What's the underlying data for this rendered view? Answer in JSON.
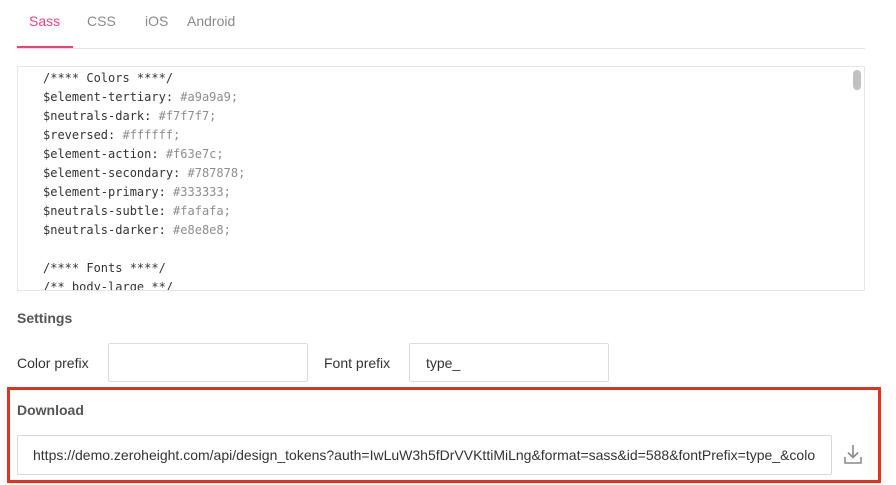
{
  "tabs": [
    {
      "label": "Sass",
      "active": true
    },
    {
      "label": "CSS",
      "active": false
    },
    {
      "label": "iOS",
      "active": false
    },
    {
      "label": "Android",
      "active": false
    }
  ],
  "code": {
    "lines": [
      {
        "text": "/**** Colors ****/",
        "kind": "comment"
      },
      {
        "name": "$element-tertiary: ",
        "value": "#a9a9a9;"
      },
      {
        "name": "$neutrals-dark: ",
        "value": "#f7f7f7;"
      },
      {
        "name": "$reversed: ",
        "value": "#ffffff;"
      },
      {
        "name": "$element-action: ",
        "value": "#f63e7c;"
      },
      {
        "name": "$element-secondary: ",
        "value": "#787878;"
      },
      {
        "name": "$element-primary: ",
        "value": "#333333;"
      },
      {
        "name": "$neutrals-subtle: ",
        "value": "#fafafa;"
      },
      {
        "name": "$neutrals-darker: ",
        "value": "#e8e8e8;"
      },
      {
        "text": "",
        "kind": "blank"
      },
      {
        "text": "/**** Fonts ****/",
        "kind": "comment"
      },
      {
        "text": "/** body-large **/",
        "kind": "comment"
      }
    ]
  },
  "settings": {
    "heading": "Settings",
    "color_prefix_label": "Color prefix",
    "color_prefix_value": "",
    "font_prefix_label": "Font prefix",
    "font_prefix_value": "type_"
  },
  "download": {
    "heading": "Download",
    "url": "https://demo.zeroheight.com/api/design_tokens?auth=IwLuW3h5fDrVVKttiMiLng&format=sass&id=588&fontPrefix=type_&colorPrefix=",
    "icon": "download-icon"
  },
  "colors": {
    "accent": "#f63e7c",
    "highlight_frame": "#e3311f"
  }
}
